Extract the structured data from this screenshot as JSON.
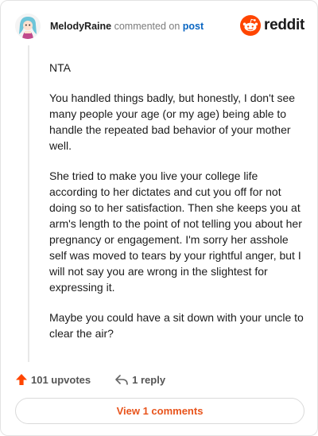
{
  "header": {
    "username": "MelodyRaine",
    "action_text": "commented on",
    "post_link": "post",
    "brand_name": "reddit"
  },
  "comment": {
    "paragraphs": [
      "NTA",
      "You handled things badly, but honestly, I don't see many people your age (or my age) being able to handle the repeated bad behavior of your mother well.",
      "She tried to make you live your college life according to her dictates and cut you off for not doing so to her satisfaction. Then she keeps you at arm's length to the point of not telling you about her pregnancy or engagement. I'm sorry her asshole self was moved to tears by your rightful anger, but I will not say you are wrong in the slightest for expressing it.",
      "Maybe you could have a sit down with your uncle to clear the air?"
    ]
  },
  "actions": {
    "upvotes_label": "101 upvotes",
    "reply_label": "1 reply",
    "view_comments_label": "View 1 comments"
  },
  "colors": {
    "accent": "#ff4500",
    "link": "#0a66c2",
    "view_button_text": "#e8541c"
  },
  "icons": {
    "avatar": "user-avatar",
    "brand": "reddit-logo-icon",
    "upvote": "upvote-arrow-icon",
    "reply": "reply-arrow-icon"
  }
}
